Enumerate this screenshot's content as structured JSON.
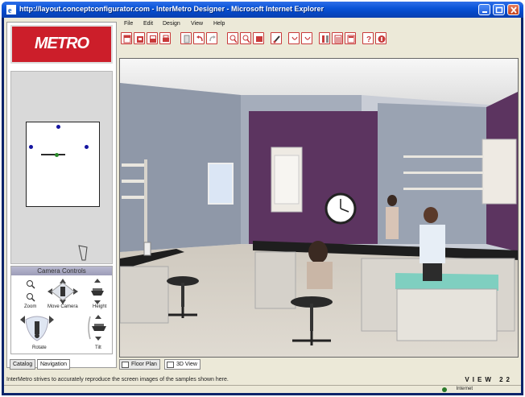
{
  "window": {
    "title": "http://layout.conceptconfigurator.com - InterMetro Designer - Microsoft Internet Explorer"
  },
  "logo": {
    "text": "METRO"
  },
  "menu": [
    "File",
    "Edit",
    "Design",
    "View",
    "Help"
  ],
  "toolbar": {
    "buttons": [
      "new-icon",
      "open-icon",
      "save-icon",
      "print-icon",
      "properties-icon",
      "undo-icon",
      "redo-icon",
      "zoom-in-icon",
      "zoom-out-icon",
      "fit-icon",
      "paint-icon",
      "rotate-left-icon",
      "rotate-right-icon",
      "mirror-icon",
      "parts-list-icon",
      "quote-icon",
      "help-icon",
      "info-icon"
    ]
  },
  "camera_controls": {
    "header": "Camera Controls",
    "labels": {
      "zoom": "Zoom",
      "move_camera": "Move Camera",
      "height": "Height",
      "rotate": "Rotate",
      "tilt": "Tilt"
    }
  },
  "left_tabs": [
    "Catalog",
    "Navigation"
  ],
  "left_tabs_active": "Navigation",
  "view_tabs": [
    "Floor Plan",
    "3D View"
  ],
  "view_tabs_active": "3D View",
  "status_text": "InterMetro strives to accurately reproduce the screen images of the samples shown here.",
  "brand_tag": "VIEW 22",
  "ie_zone": "Internet",
  "colors": {
    "brand_red": "#cc1e2a",
    "purple_wall": "#5e3561",
    "grey_wall": "#8e97a6",
    "titlebar_blue": "#0a54d8"
  }
}
